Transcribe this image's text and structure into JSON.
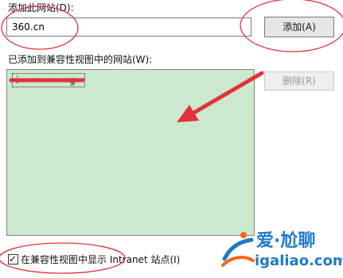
{
  "add_site": {
    "label": "添加此网站(D):",
    "input_value": "360.cn",
    "button_label": "添加(A)"
  },
  "list": {
    "label": "已添加到兼容性视图中的网站(W):",
    "items": [
      {
        "label": "i•••••••••g•••"
      }
    ]
  },
  "remove_button_label": "删除(R)",
  "intranet_option": {
    "checked": true,
    "label": "在兼容性视图中显示 Intranet 站点(I)"
  },
  "annotations": {
    "color": "#e0343a"
  },
  "watermark": {
    "brand_cn": "爱·尬聊",
    "domain": "igaliao.com",
    "colors": {
      "text": "#1e7ac9",
      "accent": "#f0681e"
    }
  },
  "colors": {
    "list_background": "#cce8cf",
    "button_background": "#e6e6e6",
    "disabled_text": "#9a9a9a"
  }
}
